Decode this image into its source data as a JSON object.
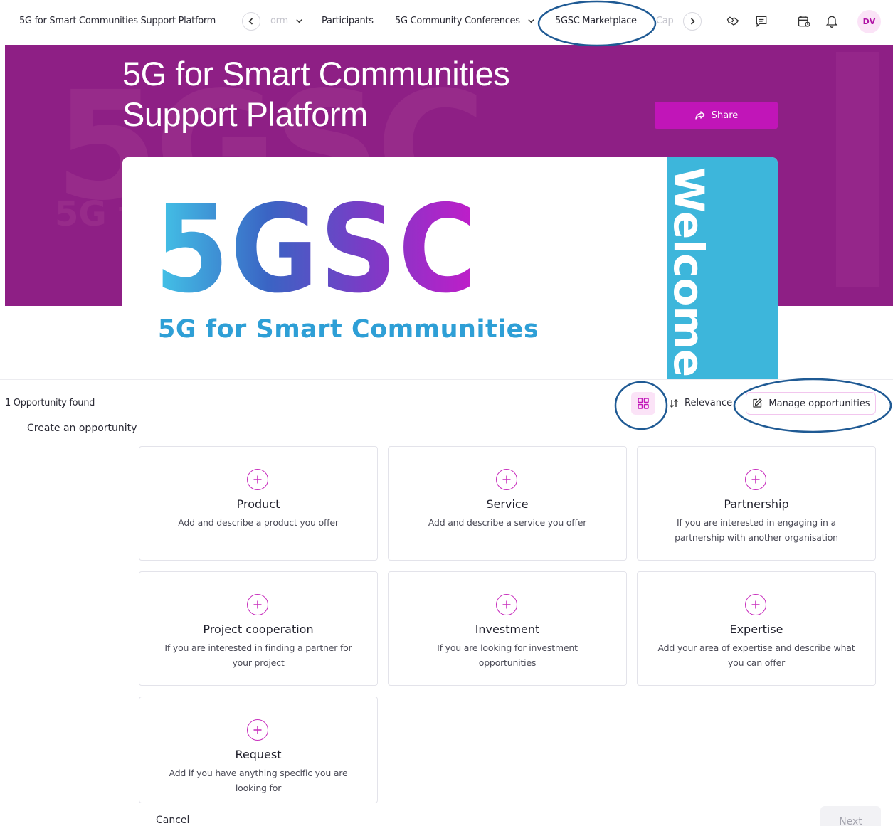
{
  "nav": {
    "brand": "5G for Smart Communities Support Platform",
    "items": [
      {
        "label": "orm",
        "faded": true,
        "has_chevron": true
      },
      {
        "label": "Participants"
      },
      {
        "label": "5G Community Conferences",
        "has_chevron": true
      },
      {
        "label": "5GSC Marketplace",
        "active": true
      },
      {
        "label": "Cap",
        "faded": true
      }
    ],
    "avatar_initials": "DV",
    "icons": [
      "chevron-left-icon",
      "chevron-right-icon",
      "handshake-icon",
      "chat-icon",
      "calendar-icon",
      "bell-icon"
    ]
  },
  "hero": {
    "title_line1": "5G for Smart Communities",
    "title_line2": "Support Platform",
    "share_label": "Share",
    "ghost_text": "5GSC",
    "ghost_sub": "5G f"
  },
  "banner": {
    "logo_text": "5GSC",
    "subtitle": "5G for Smart Communities",
    "welcome": "Welcome"
  },
  "toolbar": {
    "count_text": "1 Opportunity found",
    "sort_label": "Relevance",
    "manage_label": "Manage opportunities"
  },
  "create": {
    "heading": "Create an opportunity",
    "cards": [
      {
        "title": "Product",
        "desc": "Add and describe a product you offer"
      },
      {
        "title": "Service",
        "desc": "Add and describe a service you offer"
      },
      {
        "title": "Partnership",
        "desc": "If you are interested in engaging in a partnership with another organisation"
      },
      {
        "title": "Project cooperation",
        "desc": "If you are interested in finding a partner for your project"
      },
      {
        "title": "Investment",
        "desc": "If you are looking for investment opportunities"
      },
      {
        "title": "Expertise",
        "desc": "Add your area of expertise and describe what you can offer"
      },
      {
        "title": "Request",
        "desc": "Add if you have anything specific you are looking for"
      }
    ]
  },
  "footer": {
    "cancel_label": "Cancel",
    "next_label": "Next"
  },
  "colors": {
    "hero_bg": "#8e1f85",
    "accent": "#c115b8",
    "welcome_strip": "#3db6db",
    "annotation": "#1f5a94"
  }
}
